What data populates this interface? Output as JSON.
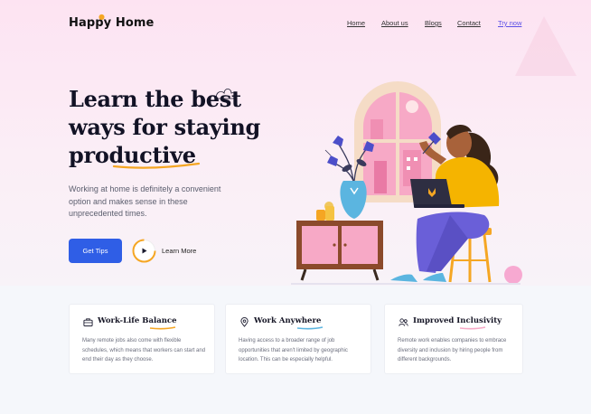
{
  "brand": {
    "name": "Happy Home",
    "accent": "#f5a623",
    "primary": "#2f5ee6",
    "nav_cta_color": "#5b50e6"
  },
  "nav": {
    "items": [
      {
        "label": "Home"
      },
      {
        "label": "About us"
      },
      {
        "label": "Blogs"
      },
      {
        "label": "Contact"
      }
    ],
    "cta": "Try now"
  },
  "hero": {
    "headline_line1": "Learn the best",
    "headline_line2": "ways for staying",
    "headline_line3": "productive",
    "subtext": "Working at home is definitely a convenient option and makes sense in these unprecedented times.",
    "primary_button": "Get Tips",
    "secondary_button": "Learn More",
    "play_icon": "play-icon"
  },
  "features": [
    {
      "icon": "briefcase-icon",
      "title": "Work-Life Balance",
      "text": "Many remote jobs also come with flexible schedules, which means that workers can start and end their day as they choose."
    },
    {
      "icon": "location-pin-icon",
      "title": "Work Anywhere",
      "text": "Having access to a broader range of job opportunities that aren't limited by geographic location. This can be especially helpful."
    },
    {
      "icon": "people-icon",
      "title": "Improved Inclusivity",
      "text": "Remote work enables companies to embrace diversity and inclusion by hiring people from different backgrounds."
    }
  ]
}
